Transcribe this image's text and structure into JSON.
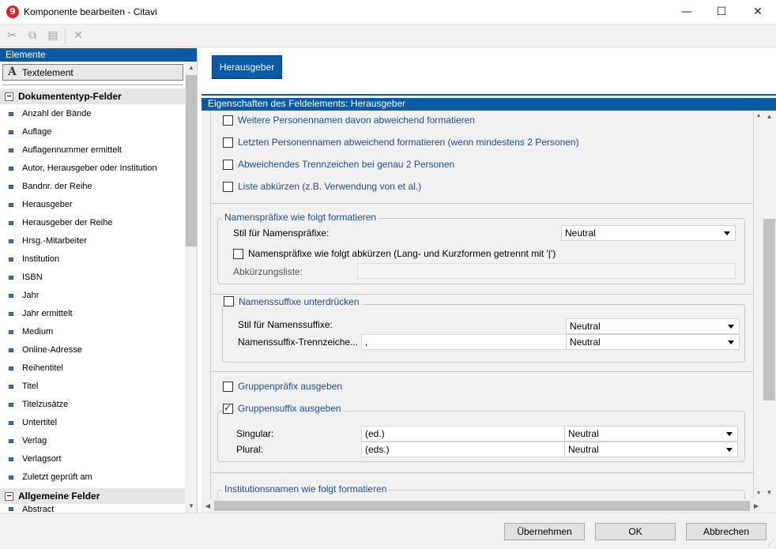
{
  "window": {
    "title": "Komponente bearbeiten - Citavi",
    "app_icon_glyph": "9",
    "minimize": "—",
    "maximize": "☐",
    "close": "✕"
  },
  "toolbar": {
    "cut_icon": "✂",
    "copy_icon": "⧉",
    "paste_icon": "▤",
    "delete_icon": "✕"
  },
  "left_panel": {
    "header": "Elemente",
    "text_element_icon": "A",
    "text_element_label": "Textelement",
    "group_dokumententyp": "Dokumententyp-Felder",
    "fields": [
      "Anzahl der Bände",
      "Auflage",
      "Auflagennummer ermittelt",
      "Autor, Herausgeber oder Institution",
      "Bandnr. der Reihe",
      "Herausgeber",
      "Herausgeber der Reihe",
      "Hrsg.-Mitarbeiter",
      "Institution",
      "ISBN",
      "Jahr",
      "Jahr ermittelt",
      "Medium",
      "Online-Adresse",
      "Reihentitel",
      "Titel",
      "Titelzusätze",
      "Untertitel",
      "Verlag",
      "Verlagsort",
      "Zuletzt geprüft am"
    ],
    "group_allgemeine": "Allgemeine Felder",
    "partial_field": "Abstract"
  },
  "preview": {
    "element_button": "Herausgeber"
  },
  "properties": {
    "header": "Eigenschaften des Feldelements:  Herausgeber",
    "checkboxes_top": [
      {
        "label": "Weitere Personennamen davon abweichend formatieren",
        "checked": false
      },
      {
        "label": "Letzten Personennamen abweichend formatieren (wenn mindestens 2 Personen)",
        "checked": false
      },
      {
        "label": "Abweichendes Trennzeichen bei genau 2 Personen",
        "checked": false
      },
      {
        "label": "Liste abkürzen (z.B. Verwendung von et al.)",
        "checked": false
      }
    ],
    "prefix_group": {
      "legend": "Namenspräfixe wie folgt formatieren",
      "style_label": "Stil für Namenspräfixe:",
      "style_value": "Neutral",
      "abbrev_checkbox": "Namenspräfixe wie folgt abkürzen (Lang- und Kurzformen getrennt mit '|')",
      "abbrev_checked": false,
      "abbrev_list_label": "Abkürzungsliste:",
      "abbrev_list_value": ""
    },
    "suffix_group": {
      "legend": "Namenssuffixe unterdrücken",
      "checked": false,
      "style_label": "Stil für Namenssuffixe:",
      "style_value": "Neutral",
      "separator_label": "Namenssuffix-Trennzeiche...",
      "separator_value": ",",
      "separator_style": "Neutral"
    },
    "group_prefix_checkbox": {
      "label": "Gruppenpräfix ausgeben",
      "checked": false
    },
    "group_suffix": {
      "legend": "Gruppensuffix ausgeben",
      "checked": true,
      "singular_label": "Singular:",
      "singular_value": "(ed.)",
      "singular_style": "Neutral",
      "plural_label": "Plural:",
      "plural_value": "(eds.)",
      "plural_style": "Neutral"
    },
    "institution_group": {
      "legend": "Institutionsnamen wie folgt formatieren"
    }
  },
  "footer": {
    "apply": "Übernehmen",
    "ok": "OK",
    "cancel": "Abbrechen"
  }
}
